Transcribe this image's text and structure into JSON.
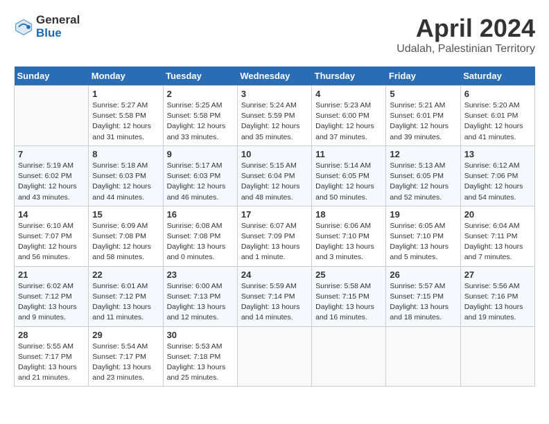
{
  "logo": {
    "line1": "General",
    "line2": "Blue"
  },
  "title": "April 2024",
  "subtitle": "Udalah, Palestinian Territory",
  "days_header": [
    "Sunday",
    "Monday",
    "Tuesday",
    "Wednesday",
    "Thursday",
    "Friday",
    "Saturday"
  ],
  "weeks": [
    [
      {
        "num": "",
        "info": ""
      },
      {
        "num": "1",
        "info": "Sunrise: 5:27 AM\nSunset: 5:58 PM\nDaylight: 12 hours\nand 31 minutes."
      },
      {
        "num": "2",
        "info": "Sunrise: 5:25 AM\nSunset: 5:58 PM\nDaylight: 12 hours\nand 33 minutes."
      },
      {
        "num": "3",
        "info": "Sunrise: 5:24 AM\nSunset: 5:59 PM\nDaylight: 12 hours\nand 35 minutes."
      },
      {
        "num": "4",
        "info": "Sunrise: 5:23 AM\nSunset: 6:00 PM\nDaylight: 12 hours\nand 37 minutes."
      },
      {
        "num": "5",
        "info": "Sunrise: 5:21 AM\nSunset: 6:01 PM\nDaylight: 12 hours\nand 39 minutes."
      },
      {
        "num": "6",
        "info": "Sunrise: 5:20 AM\nSunset: 6:01 PM\nDaylight: 12 hours\nand 41 minutes."
      }
    ],
    [
      {
        "num": "7",
        "info": "Sunrise: 5:19 AM\nSunset: 6:02 PM\nDaylight: 12 hours\nand 43 minutes."
      },
      {
        "num": "8",
        "info": "Sunrise: 5:18 AM\nSunset: 6:03 PM\nDaylight: 12 hours\nand 44 minutes."
      },
      {
        "num": "9",
        "info": "Sunrise: 5:17 AM\nSunset: 6:03 PM\nDaylight: 12 hours\nand 46 minutes."
      },
      {
        "num": "10",
        "info": "Sunrise: 5:15 AM\nSunset: 6:04 PM\nDaylight: 12 hours\nand 48 minutes."
      },
      {
        "num": "11",
        "info": "Sunrise: 5:14 AM\nSunset: 6:05 PM\nDaylight: 12 hours\nand 50 minutes."
      },
      {
        "num": "12",
        "info": "Sunrise: 5:13 AM\nSunset: 6:05 PM\nDaylight: 12 hours\nand 52 minutes."
      },
      {
        "num": "13",
        "info": "Sunrise: 6:12 AM\nSunset: 7:06 PM\nDaylight: 12 hours\nand 54 minutes."
      }
    ],
    [
      {
        "num": "14",
        "info": "Sunrise: 6:10 AM\nSunset: 7:07 PM\nDaylight: 12 hours\nand 56 minutes."
      },
      {
        "num": "15",
        "info": "Sunrise: 6:09 AM\nSunset: 7:08 PM\nDaylight: 12 hours\nand 58 minutes."
      },
      {
        "num": "16",
        "info": "Sunrise: 6:08 AM\nSunset: 7:08 PM\nDaylight: 13 hours\nand 0 minutes."
      },
      {
        "num": "17",
        "info": "Sunrise: 6:07 AM\nSunset: 7:09 PM\nDaylight: 13 hours\nand 1 minute."
      },
      {
        "num": "18",
        "info": "Sunrise: 6:06 AM\nSunset: 7:10 PM\nDaylight: 13 hours\nand 3 minutes."
      },
      {
        "num": "19",
        "info": "Sunrise: 6:05 AM\nSunset: 7:10 PM\nDaylight: 13 hours\nand 5 minutes."
      },
      {
        "num": "20",
        "info": "Sunrise: 6:04 AM\nSunset: 7:11 PM\nDaylight: 13 hours\nand 7 minutes."
      }
    ],
    [
      {
        "num": "21",
        "info": "Sunrise: 6:02 AM\nSunset: 7:12 PM\nDaylight: 13 hours\nand 9 minutes."
      },
      {
        "num": "22",
        "info": "Sunrise: 6:01 AM\nSunset: 7:12 PM\nDaylight: 13 hours\nand 11 minutes."
      },
      {
        "num": "23",
        "info": "Sunrise: 6:00 AM\nSunset: 7:13 PM\nDaylight: 13 hours\nand 12 minutes."
      },
      {
        "num": "24",
        "info": "Sunrise: 5:59 AM\nSunset: 7:14 PM\nDaylight: 13 hours\nand 14 minutes."
      },
      {
        "num": "25",
        "info": "Sunrise: 5:58 AM\nSunset: 7:15 PM\nDaylight: 13 hours\nand 16 minutes."
      },
      {
        "num": "26",
        "info": "Sunrise: 5:57 AM\nSunset: 7:15 PM\nDaylight: 13 hours\nand 18 minutes."
      },
      {
        "num": "27",
        "info": "Sunrise: 5:56 AM\nSunset: 7:16 PM\nDaylight: 13 hours\nand 19 minutes."
      }
    ],
    [
      {
        "num": "28",
        "info": "Sunrise: 5:55 AM\nSunset: 7:17 PM\nDaylight: 13 hours\nand 21 minutes."
      },
      {
        "num": "29",
        "info": "Sunrise: 5:54 AM\nSunset: 7:17 PM\nDaylight: 13 hours\nand 23 minutes."
      },
      {
        "num": "30",
        "info": "Sunrise: 5:53 AM\nSunset: 7:18 PM\nDaylight: 13 hours\nand 25 minutes."
      },
      {
        "num": "",
        "info": ""
      },
      {
        "num": "",
        "info": ""
      },
      {
        "num": "",
        "info": ""
      },
      {
        "num": "",
        "info": ""
      }
    ]
  ]
}
